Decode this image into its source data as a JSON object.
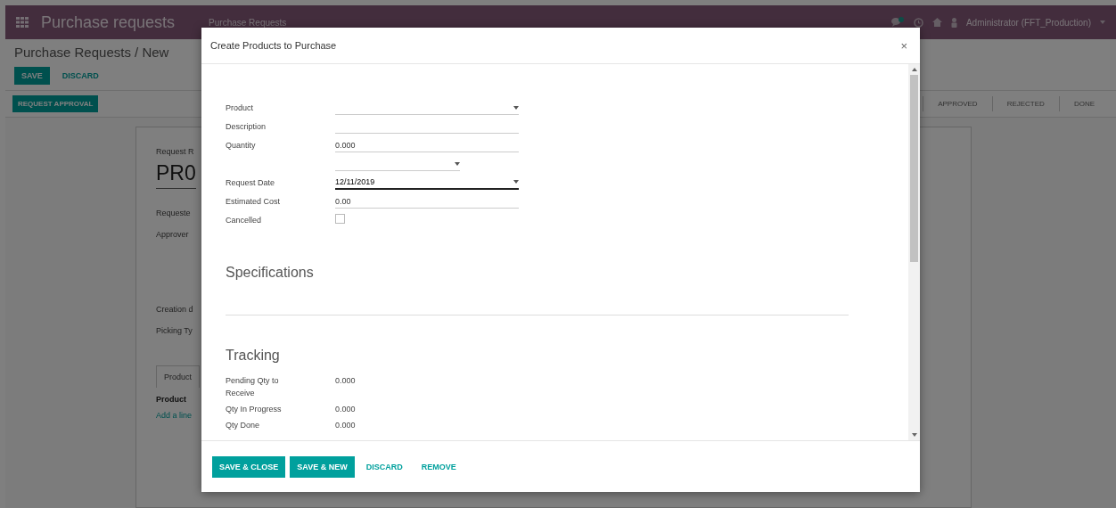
{
  "navbar": {
    "app_title": "Purchase requests",
    "menu": [
      "Purchase Requests"
    ],
    "user": "Administrator (FFT_Production)"
  },
  "control_panel": {
    "breadcrumb": "Purchase Requests / New",
    "buttons": [
      {
        "label": "SAVE",
        "kind": "primary"
      },
      {
        "label": "DISCARD",
        "kind": "link"
      }
    ]
  },
  "statusbar": {
    "actions": [
      "REQUEST APPROVAL"
    ],
    "stages": [
      "APPROVED",
      "REJECTED",
      "DONE"
    ]
  },
  "sheet": {
    "items": [
      {
        "kind": "label",
        "text": "Request R"
      },
      {
        "kind": "title",
        "text": "PR0"
      },
      {
        "kind": "label",
        "text": "Requeste"
      },
      {
        "kind": "label",
        "text": "Approver"
      },
      {
        "kind": "gap"
      },
      {
        "kind": "label",
        "text": "Creation d"
      },
      {
        "kind": "label",
        "text": "Picking Ty"
      },
      {
        "kind": "tab",
        "text": "Product"
      },
      {
        "kind": "column",
        "text": "Product"
      },
      {
        "kind": "link",
        "text": "Add a line"
      }
    ]
  },
  "dialog": {
    "title": "Create Products to Purchase",
    "close": "×",
    "fields": [
      {
        "label": "Product",
        "kind": "select",
        "focused": false
      },
      {
        "label": "Description",
        "kind": "text",
        "focused": false
      },
      {
        "label": "Quantity",
        "kind": "text",
        "value": "0.000",
        "focused": false
      },
      {
        "kind": "select",
        "short": true,
        "focused": false
      },
      {
        "label": "Request Date",
        "kind": "select",
        "value": "12/11/2019",
        "focused": true
      },
      {
        "label": "Estimated Cost",
        "kind": "text",
        "value": "0.00",
        "focused": false
      },
      {
        "label": "Cancelled",
        "kind": "checkbox",
        "checked": false,
        "focused": false
      }
    ],
    "sections": [
      {
        "title": "Specifications",
        "divider": true
      },
      {
        "title": "Tracking",
        "rows": [
          {
            "label": "Pending Qty to Receive",
            "value": "0.000"
          },
          {
            "label": "Qty In Progress",
            "value": "0.000"
          },
          {
            "label": "Qty Done",
            "value": "0.000"
          }
        ]
      }
    ],
    "buttons": [
      {
        "label": "SAVE & CLOSE",
        "kind": "primary"
      },
      {
        "label": "SAVE & NEW",
        "kind": "primary"
      },
      {
        "label": "DISCARD",
        "kind": "link"
      },
      {
        "label": "REMOVE",
        "kind": "link"
      }
    ]
  }
}
